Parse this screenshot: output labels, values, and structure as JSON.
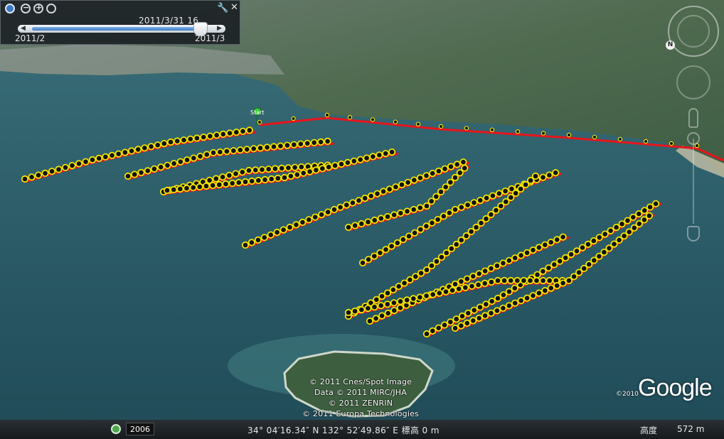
{
  "colors": {
    "track_line": "#e8141c",
    "marker_fill": "#f2e400",
    "marker_stroke": "#111111",
    "start_pin": "#38d238"
  },
  "map": {
    "start_label": "Start"
  },
  "time_slider": {
    "current_date": "2011/3/31  16",
    "start_label": "2011/2",
    "end_label": "2011/3",
    "position_fraction": 0.9,
    "icons": [
      "clock-icon",
      "zoom-out-icon",
      "zoom-in-icon",
      "reset-icon",
      "wrench-icon",
      "close-icon"
    ],
    "close_symbol": "✕",
    "wrench_symbol": "🔧"
  },
  "navigation": {
    "north_label": "N"
  },
  "attribution": {
    "lines": [
      "© 2011 Cnes/Spot Image",
      "Data © 2011 MIRC/JHA",
      "© 2011 ZENRIN",
      "© 2011 Europa Technologies"
    ],
    "logo_year": "©2010",
    "logo_text": "Google"
  },
  "status_bar": {
    "imagery_year": "2006",
    "coordinates": "34° 04′16.34″ N 132° 52′49.86″ E 標高    0 m",
    "altitude_label": "高度",
    "altitude_value": "572 m"
  }
}
